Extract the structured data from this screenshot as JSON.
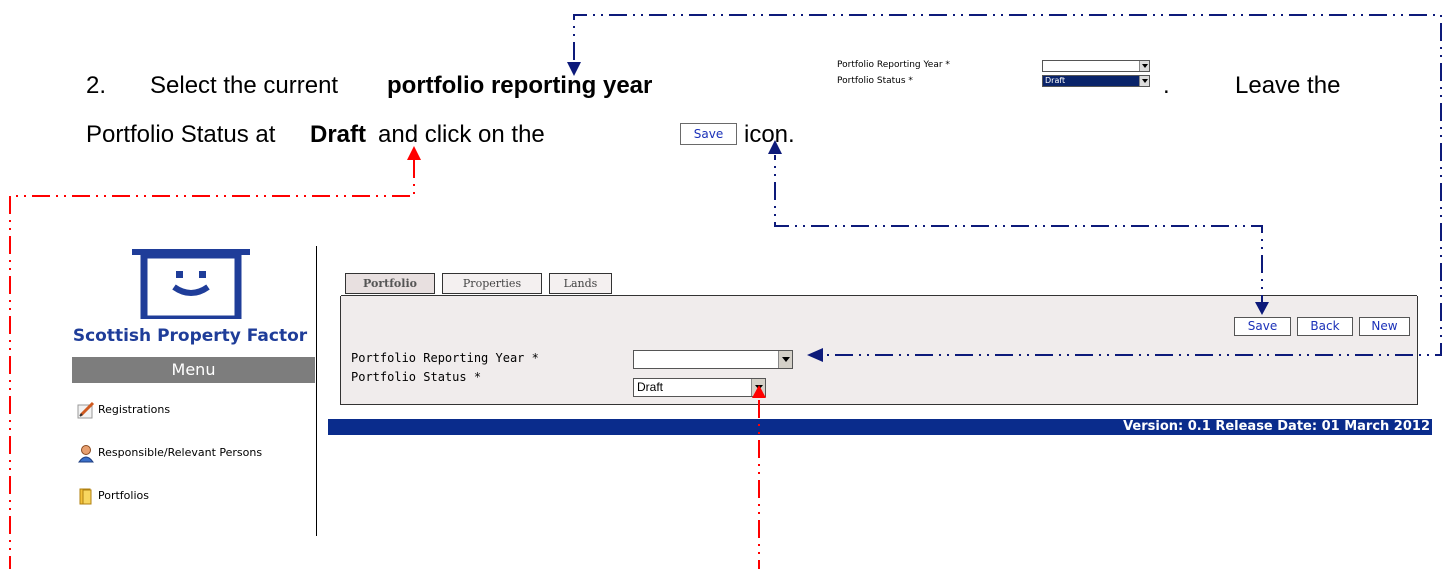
{
  "instruction": {
    "step_number": "2.",
    "line1_part1": "Select the current",
    "line1_bold": "portfolio reporting year",
    "line1_part2": ".",
    "line1_part3": "Leave the",
    "line2_part1": "Portfolio Status at",
    "line2_bold": "Draft",
    "line2_part2": "and click on the",
    "line2_part3": "icon.",
    "inline_save_label": "Save"
  },
  "mini_form": {
    "reporting_year_label": "Portfolio Reporting Year *",
    "status_label": "Portfolio Status *",
    "status_value": "Draft"
  },
  "sidebar": {
    "brand": "Scottish Property Factor",
    "menu_title": "Menu",
    "items": [
      {
        "label": "Registrations",
        "icon": "registration-pen-icon"
      },
      {
        "label": "Responsible/Relevant Persons",
        "icon": "person-icon"
      },
      {
        "label": "Portfolios",
        "icon": "folder-icon"
      }
    ]
  },
  "tabs": [
    {
      "label": "Portfolio",
      "active": true
    },
    {
      "label": "Properties",
      "active": false
    },
    {
      "label": "Lands",
      "active": false
    }
  ],
  "toolbar": {
    "save_label": "Save",
    "back_label": "Back",
    "new_label": "New"
  },
  "form": {
    "reporting_year_label": "Portfolio Reporting Year *",
    "reporting_year_value": "",
    "status_label": "Portfolio Status *",
    "status_value": "Draft"
  },
  "footer": {
    "version_text": "Version: 0.1 Release Date: 01 March 2012"
  },
  "colors": {
    "brand_blue": "#1f3d99",
    "version_bar": "#0a2c8c",
    "navy_arrow": "#0d1a7a",
    "red_arrow": "#ff0000"
  }
}
